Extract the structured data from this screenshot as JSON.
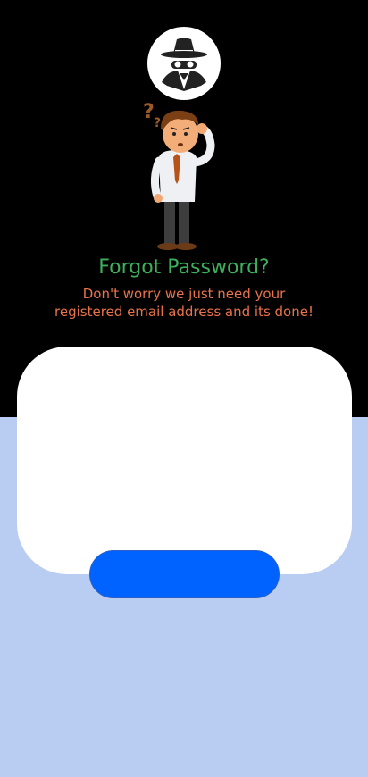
{
  "logo": {
    "icon": "spy-icon"
  },
  "illustration": {
    "icon": "confused-man-illustration"
  },
  "header": {
    "title": "Forgot Password?",
    "subtitle": "Don't worry we just need your registered email address and its done!"
  },
  "form": {
    "submit_label": ""
  },
  "colors": {
    "top_background": "#000000",
    "bottom_background": "#b9cdf2",
    "title": "#3daf5c",
    "subtitle": "#e8734a",
    "button": "#0063ff"
  }
}
